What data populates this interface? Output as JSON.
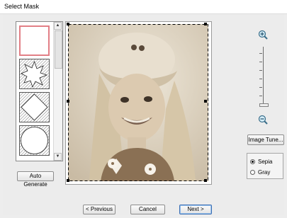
{
  "window": {
    "title": "Select Mask"
  },
  "mask_list": {
    "items": [
      {
        "name": "rectangle-mask",
        "selected": true
      },
      {
        "name": "star-mask",
        "selected": false
      },
      {
        "name": "diamond-mask",
        "selected": false
      },
      {
        "name": "circle-mask",
        "selected": false
      }
    ]
  },
  "buttons": {
    "auto_generate": "Auto Generate",
    "image_tune": "Image Tune...",
    "previous": "< Previous",
    "cancel": "Cancel",
    "next": "Next >"
  },
  "zoom": {
    "in_icon": "zoom-in-icon",
    "out_icon": "zoom-out-icon"
  },
  "color_mode": {
    "options": [
      {
        "label": "Sepia",
        "checked": true
      },
      {
        "label": "Gray",
        "checked": false
      }
    ]
  },
  "colors": {
    "selected_mask": "#e27f86",
    "accent": "#3c6fb4"
  }
}
